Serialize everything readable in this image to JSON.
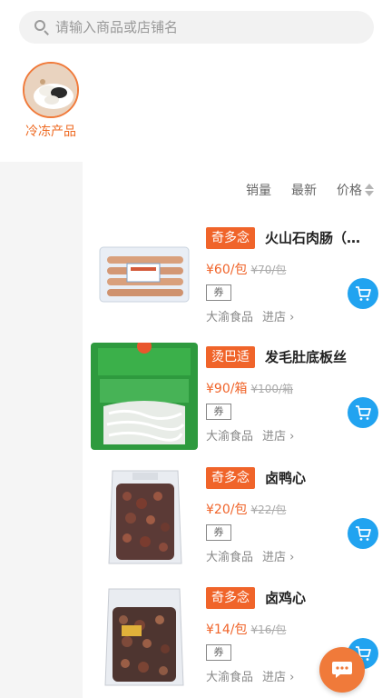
{
  "search": {
    "placeholder": "请输入商品或店铺名"
  },
  "category": {
    "label": "冷冻产品"
  },
  "sort": {
    "sales": "销量",
    "newest": "最新",
    "price": "价格"
  },
  "products": [
    {
      "tag": "奇多念",
      "name": "火山石肉肠（…",
      "price": "¥60/包",
      "old_price": "¥70/包",
      "coupon": "券",
      "shop": "大渝食品",
      "go": "进店 ›"
    },
    {
      "tag": "烫巴适",
      "name": "发毛肚底板丝",
      "price": "¥90/箱",
      "old_price": "¥100/箱",
      "coupon": "券",
      "shop": "大渝食品",
      "go": "进店 ›"
    },
    {
      "tag": "奇多念",
      "name": "卤鸭心",
      "price": "¥20/包",
      "old_price": "¥22/包",
      "coupon": "券",
      "shop": "大渝食品",
      "go": "进店 ›"
    },
    {
      "tag": "奇多念",
      "name": "卤鸡心",
      "price": "¥14/包",
      "old_price": "¥16/包",
      "coupon": "券",
      "shop": "大渝食品",
      "go": "进店 ›"
    }
  ],
  "colors": {
    "accent": "#f0642a",
    "cart": "#21a3f0",
    "fab": "#f07a3a"
  }
}
